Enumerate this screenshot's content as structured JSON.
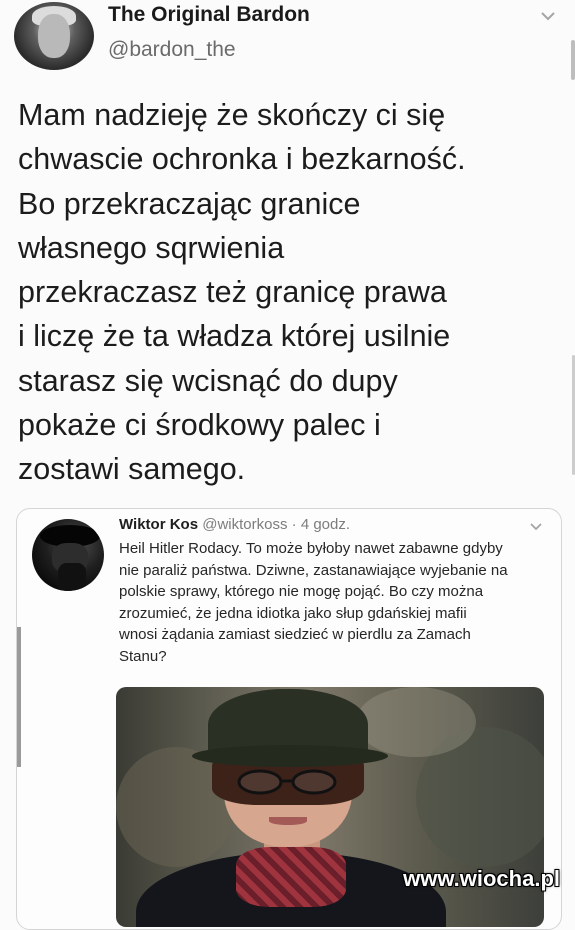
{
  "tweet": {
    "author_name": "The Original Bardon",
    "author_handle": "@bardon_the",
    "text_lines": [
      "Mam nadzieję że skończy ci się",
      "chwascie ochronka i bezkarność.",
      "Bo przekraczając granice",
      "własnego sqrwienia",
      "przekraczasz też granicę prawa",
      "i liczę że ta władza której usilnie",
      "starasz się wcisnąć do dupy",
      "pokaże ci środkowy palec i",
      "zostawi samego."
    ]
  },
  "quoted_tweet": {
    "author_name": "Wiktor Kos",
    "author_handle": "@wiktorkoss",
    "timestamp": "4 godz.",
    "separator": "·",
    "text_lines": [
      "Heil Hitler Rodacy. To może byłoby nawet zabawne gdyby",
      "nie paraliż państwa. Dziwne, zastanawiające wyjebanie na",
      "polskie sprawy, którego nie mogę pojąć. Bo czy można",
      "zrozumieć, że jedna idiotka jako słup gdańskiej mafii",
      "wnosi żądania zamiast siedzieć w pierdlu za Zamach",
      "Stanu?"
    ]
  },
  "watermark": "www.wiocha.pl",
  "icons": {
    "author_menu": "chevron-down-icon",
    "quote_menu": "chevron-down-icon"
  },
  "colors": {
    "background": "#fbfbfb",
    "text": "#1c1c1c",
    "handle": "#6b6b6b"
  }
}
